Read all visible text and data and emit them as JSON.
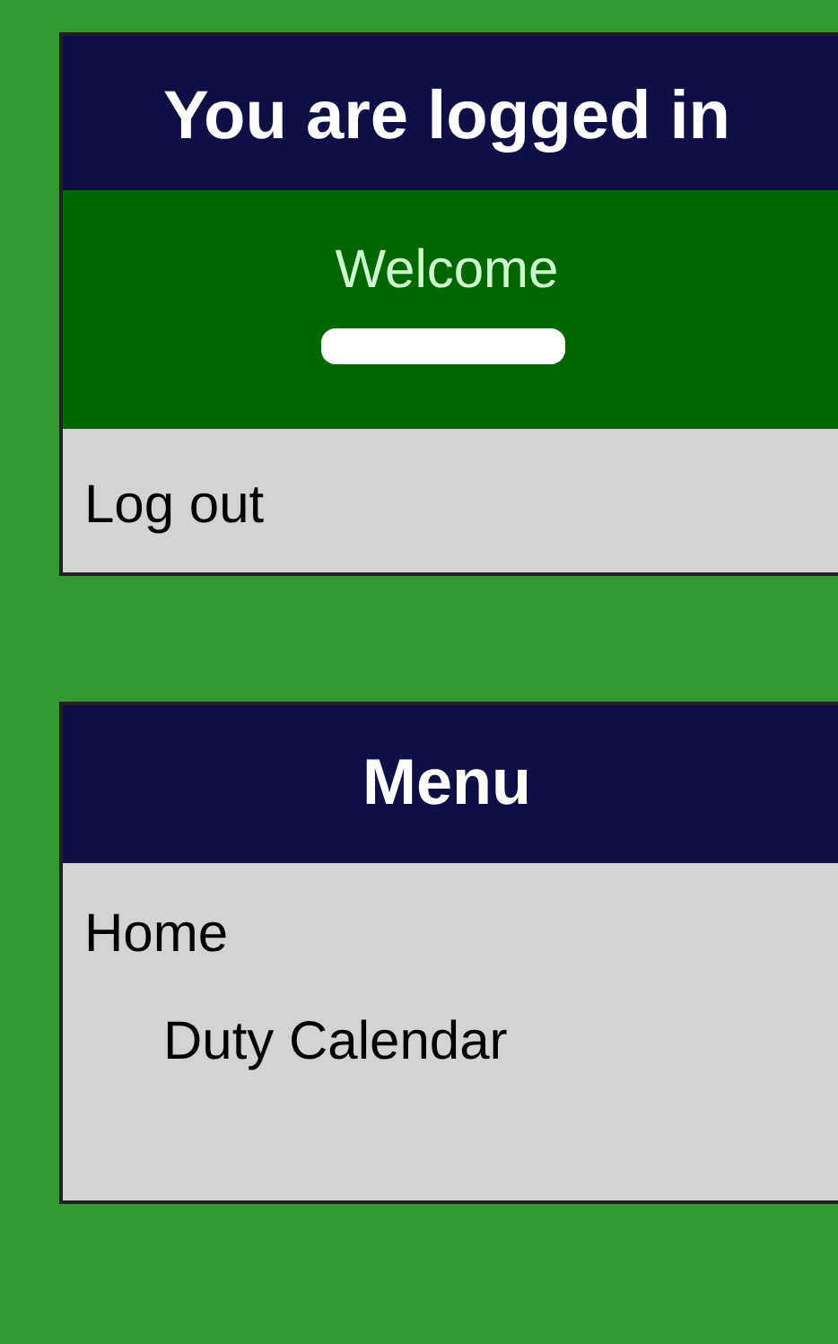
{
  "login_panel": {
    "title": "You are logged in",
    "greeting": "Welcome",
    "logout_link": "Log out"
  },
  "menu_panel": {
    "title": "Menu",
    "items": [
      {
        "label": "Home",
        "children": [
          {
            "label": "Duty Calendar"
          }
        ]
      }
    ]
  }
}
